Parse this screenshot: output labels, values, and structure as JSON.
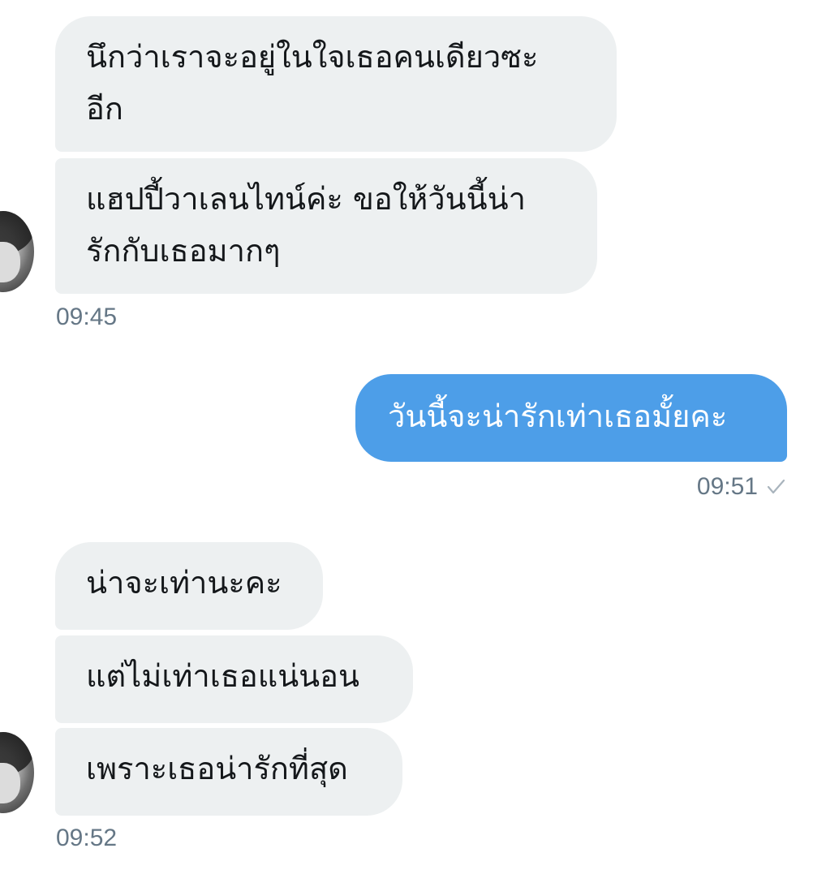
{
  "conversation": {
    "group1": {
      "messages": [
        {
          "lines": [
            "นึกว่าเราจะอยู่ในใจเธอคนเดียวซะ",
            "อีก"
          ]
        },
        {
          "lines": [
            "แฮปปี้วาเลนไทน์ค่ะ ขอให้วันนี้น่า",
            "รักกับเธอมากๆ"
          ]
        }
      ],
      "time": "09:45"
    },
    "group2": {
      "messages": [
        {
          "lines": [
            "วันนี้จะน่ารักเท่าเธอมั้ยคะ"
          ]
        }
      ],
      "time": "09:51",
      "status_icon": "check-icon"
    },
    "group3": {
      "messages": [
        {
          "lines": [
            "น่าจะเท่านะคะ"
          ]
        },
        {
          "lines": [
            "แต่ไม่เท่าเธอแน่นอน"
          ]
        },
        {
          "lines": [
            "เพราะเธอน่ารักที่สุด"
          ]
        }
      ],
      "time": "09:52"
    }
  },
  "colors": {
    "incoming_bubble": "#edf0f1",
    "outgoing_bubble": "#4d9ee8",
    "timestamp": "#657786",
    "message_text": "#14171a"
  }
}
